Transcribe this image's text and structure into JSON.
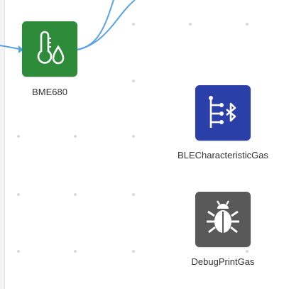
{
  "colors": {
    "wire": "#5aa2e6",
    "bme680": "#2e8b3a",
    "ble": "#2a3fa8",
    "debug": "#595959",
    "grid_dot": "#d9d9d9"
  },
  "nodes": [
    {
      "id": "bme680",
      "label": "BME680",
      "icon": "thermometer-drop-icon"
    },
    {
      "id": "ble",
      "label": "BLECharacteristicGas",
      "icon": "bluetooth-le-tree-icon"
    },
    {
      "id": "debug",
      "label": "DebugPrintGas",
      "icon": "bug-icon"
    }
  ]
}
